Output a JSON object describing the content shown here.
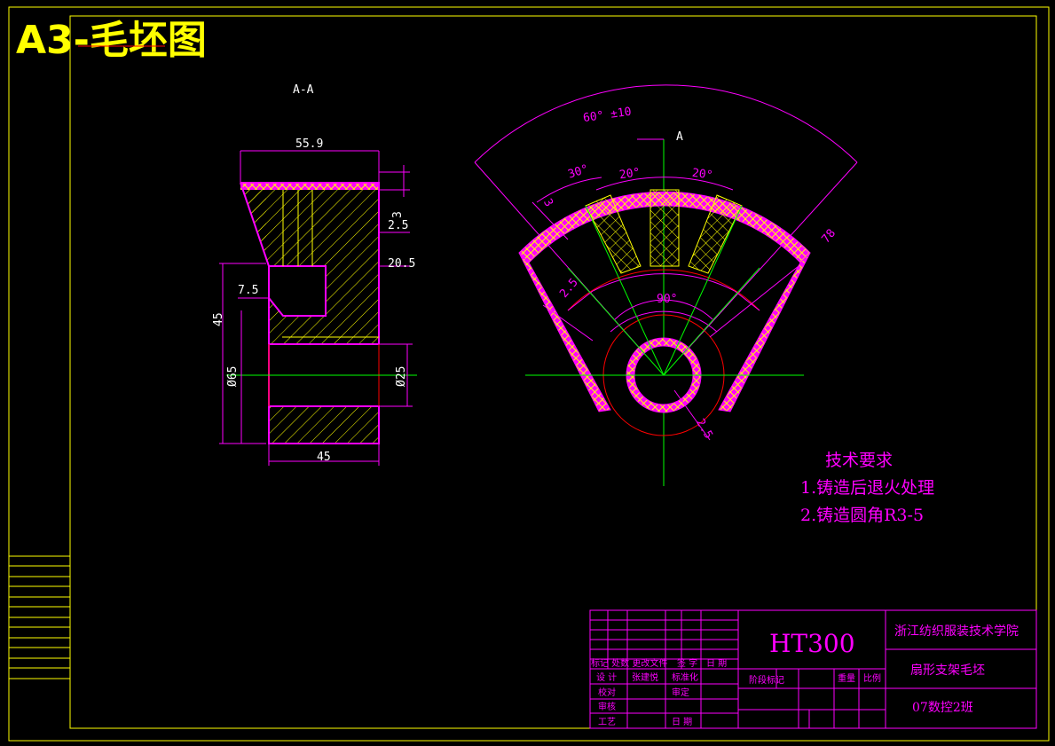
{
  "drawing": {
    "title": "A3-毛坯图",
    "section_label": "A-A",
    "view_label": "A"
  },
  "section_dims": {
    "top_width": "55.9",
    "top_small": "3",
    "right_1": "2.5",
    "right_2": "20.5",
    "left_step": "7.5",
    "height_45": "45",
    "dia_65": "Ø65",
    "dia_25": "Ø25",
    "bottom_width": "45"
  },
  "fan_dims": {
    "outer_angle": "60° ±10",
    "angle_30": "30°",
    "angle_20a": "20°",
    "angle_20b": "20°",
    "angle_90": "90°",
    "wall_3": "3",
    "wall_2_5": "2.5",
    "right_78": "78",
    "hub_2_5": "2.5"
  },
  "notes": {
    "heading": "技术要求",
    "item1": "1.铸造后退火处理",
    "item2": "2.铸造圆角R3-5"
  },
  "title_block": {
    "material": "HT300",
    "school": "浙江纺织服装技术学院",
    "part_name": "扇形支架毛坯",
    "class_name": "07数控2班",
    "row_change": "标记 处数 更改文件",
    "sign": "签 字",
    "date_h": "日 期",
    "design": "设 计",
    "designer": "张建悦",
    "standard": "标准化",
    "proof": "校对",
    "review": "审定",
    "audit": "审核",
    "process": "工艺",
    "date": "日 期",
    "stage_mark": "阶段标记",
    "weight": "重量",
    "scale": "比例"
  }
}
